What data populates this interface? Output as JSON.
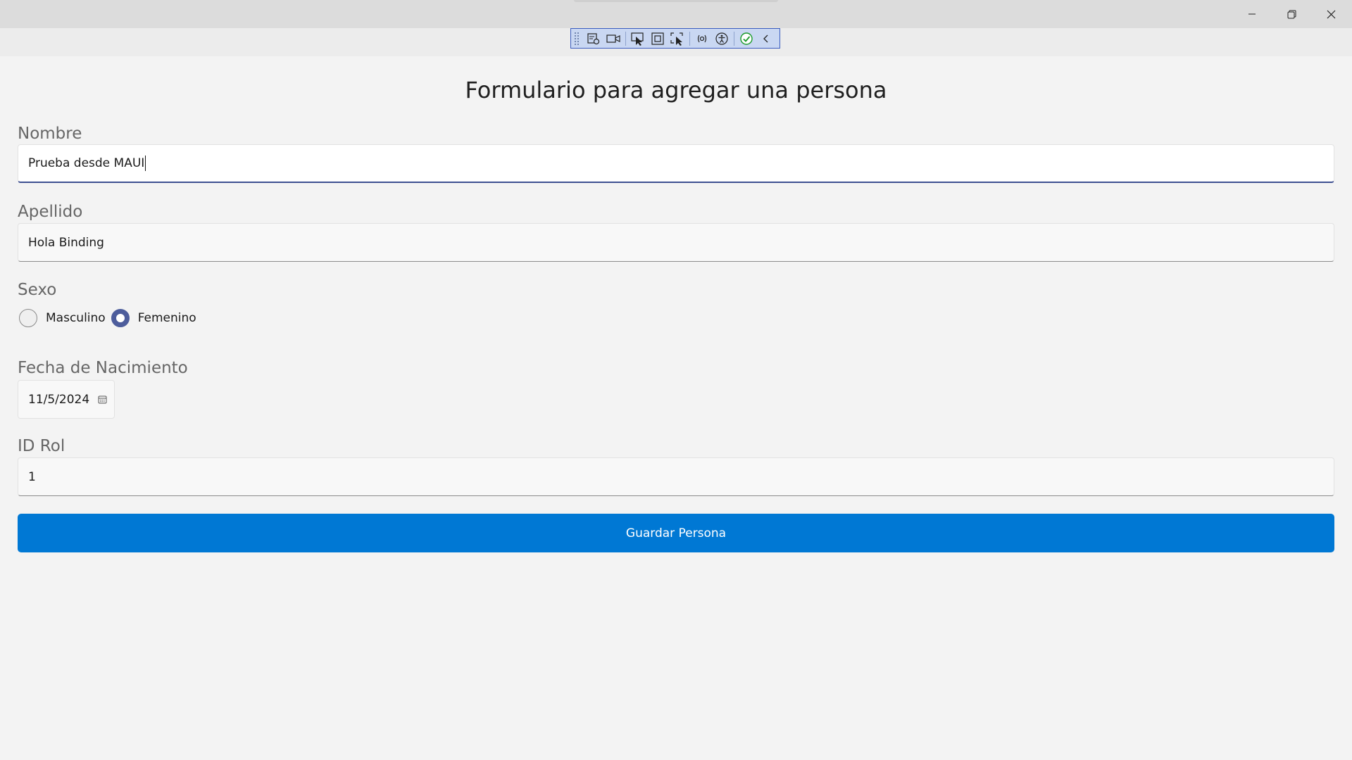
{
  "window": {
    "minimize_icon": "minimize-icon",
    "maximize_icon": "restore-icon",
    "close_icon": "close-icon"
  },
  "devtools": {
    "tools": [
      "live-visual-tree-icon",
      "record-icon",
      "select-element-icon",
      "display-layout-adorners-icon",
      "track-focused-element-icon",
      "binding-failures-icon",
      "accessibility-checker-icon",
      "scan-ok-icon",
      "collapse-chevron-icon"
    ],
    "accent_color": "#3b5dbf"
  },
  "form": {
    "title": "Formulario para agregar una persona",
    "nombre": {
      "label": "Nombre",
      "value": "Prueba desde MAUI"
    },
    "apellido": {
      "label": "Apellido",
      "value": "Hola Binding"
    },
    "sexo": {
      "label": "Sexo",
      "options": [
        {
          "label": "Masculino",
          "checked": false
        },
        {
          "label": "Femenino",
          "checked": true
        }
      ]
    },
    "fecha": {
      "label": "Fecha de Nacimiento",
      "value": "11/5/2024"
    },
    "rol": {
      "label": "ID Rol",
      "value": "1"
    },
    "save_label": "Guardar Persona"
  },
  "colors": {
    "primary_button": "#0078d4",
    "radio_checked": "#4d5d9c",
    "focus_underline": "#3d4f91",
    "background": "#f3f3f3"
  }
}
